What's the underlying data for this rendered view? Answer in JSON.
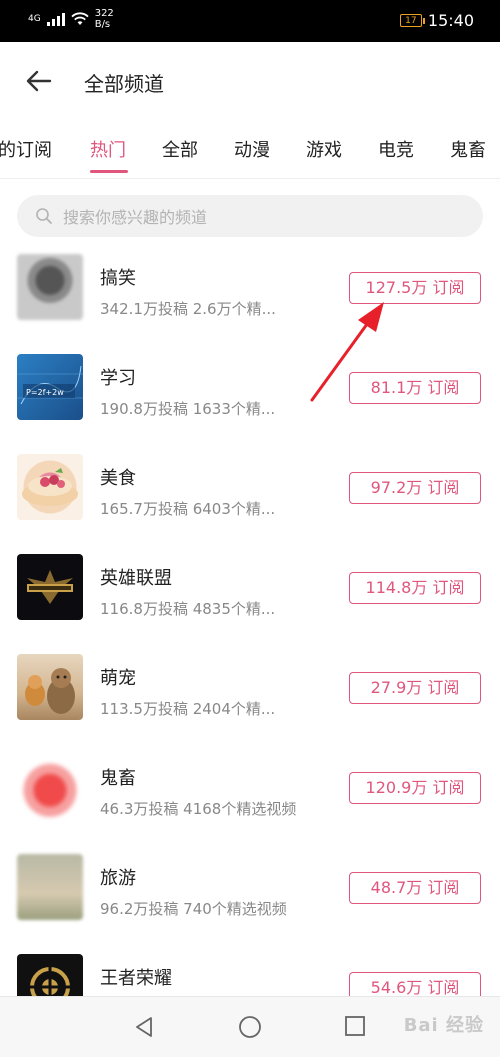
{
  "status_bar": {
    "network": "4G",
    "speed_value": "322",
    "speed_unit": "B/s",
    "battery": "17",
    "time": "15:40"
  },
  "header": {
    "title": "全部频道"
  },
  "tabs": [
    {
      "label": "的订阅"
    },
    {
      "label": "热门",
      "active": true
    },
    {
      "label": "全部"
    },
    {
      "label": "动漫"
    },
    {
      "label": "游戏"
    },
    {
      "label": "电竞"
    },
    {
      "label": "鬼畜"
    }
  ],
  "search": {
    "placeholder": "搜索你感兴趣的频道",
    "value": ""
  },
  "channels": [
    {
      "name": "搞笑",
      "meta": "342.1万投稿  2.6万个精...",
      "subscribe": "127.5万 订阅"
    },
    {
      "name": "学习",
      "meta": "190.8万投稿  1633个精...",
      "subscribe": "81.1万 订阅"
    },
    {
      "name": "美食",
      "meta": "165.7万投稿  6403个精...",
      "subscribe": "97.2万 订阅"
    },
    {
      "name": "英雄联盟",
      "meta": "116.8万投稿  4835个精...",
      "subscribe": "114.8万 订阅"
    },
    {
      "name": "萌宠",
      "meta": "113.5万投稿  2404个精...",
      "subscribe": "27.9万 订阅"
    },
    {
      "name": "鬼畜",
      "meta": "46.3万投稿  4168个精选视频",
      "subscribe": "120.9万 订阅"
    },
    {
      "name": "旅游",
      "meta": "96.2万投稿  740个精选视频",
      "subscribe": "48.7万 订阅"
    },
    {
      "name": "王者荣耀",
      "meta": "",
      "subscribe": "54.6万 订阅"
    }
  ],
  "thumb_text": {
    "study": "P=2f+2w"
  },
  "watermark": "Bai 经验",
  "colors": {
    "accent": "#e0567d",
    "annotation": "#e8202a"
  }
}
